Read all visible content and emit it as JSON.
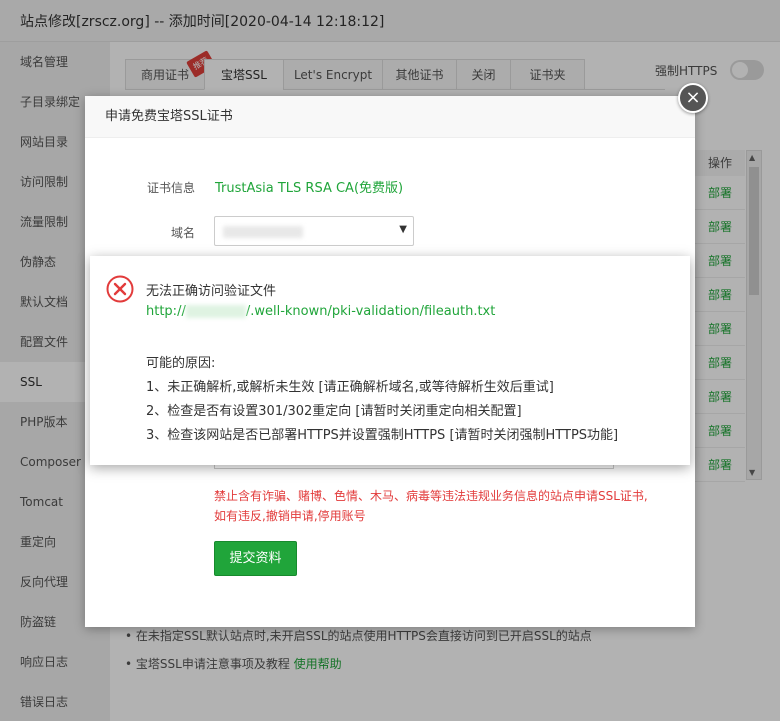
{
  "window": {
    "title": "站点修改[zrscz.org] -- 添加时间[2020-04-14 12:18:12]"
  },
  "sidebar": {
    "items": [
      {
        "label": "域名管理"
      },
      {
        "label": "子目录绑定"
      },
      {
        "label": "网站目录"
      },
      {
        "label": "访问限制"
      },
      {
        "label": "流量限制"
      },
      {
        "label": "伪静态"
      },
      {
        "label": "默认文档"
      },
      {
        "label": "配置文件"
      },
      {
        "label": "SSL"
      },
      {
        "label": "PHP版本"
      },
      {
        "label": "Composer"
      },
      {
        "label": "Tomcat"
      },
      {
        "label": "重定向"
      },
      {
        "label": "反向代理"
      },
      {
        "label": "防盗链"
      },
      {
        "label": "响应日志"
      },
      {
        "label": "错误日志"
      }
    ],
    "active_index": 8
  },
  "tabs": {
    "items": [
      {
        "label": "商用证书"
      },
      {
        "label": "宝塔SSL"
      },
      {
        "label": "Let's Encrypt"
      },
      {
        "label": "其他证书"
      },
      {
        "label": "关闭"
      },
      {
        "label": "证书夹"
      }
    ],
    "badge": "推荐",
    "active_index": 1
  },
  "https": {
    "label": "强制HTTPS",
    "enabled": false
  },
  "table": {
    "op_header": "操作",
    "op_links": [
      "部署",
      "部署",
      "部署",
      "部署",
      "部署",
      "部署",
      "部署",
      "部署",
      "部署"
    ]
  },
  "tips": [
    {
      "text": "在未指定SSL默认站点时,未开启SSL的站点使用HTTPS会直接访问到已开启SSL的站点",
      "link": ""
    },
    {
      "text": "宝塔SSL申请注意事项及教程 ",
      "link": "使用帮助"
    }
  ],
  "dialog": {
    "title": "申请免费宝塔SSL证书",
    "close_icon": "close-icon",
    "cert_label": "证书信息",
    "cert_value": "TrustAsia TLS RSA CA(免费版)",
    "domain_label": "域名",
    "domain_value": "",
    "warning_line1": "禁止含有诈骗、赌博、色情、木马、病毒等违法违规业务信息的站点申请SSL证书,",
    "warning_line2": "如有违反,撤销申请,停用账号",
    "submit_label": "提交资料"
  },
  "error": {
    "icon": "error-circle-icon",
    "title": "无法正确访问验证文件",
    "url_prefix": "http://",
    "url_suffix": "/.well-known/pki-validation/fileauth.txt",
    "reasons_title": "可能的原因:",
    "reasons": [
      "1、未正确解析,或解析未生效 [请正确解析域名,或等待解析生效后重试]",
      "2、检查是否有设置301/302重定向 [请暂时关闭重定向相关配置]",
      "3、检查该网站是否已部署HTTPS并设置强制HTTPS [请暂时关闭强制HTTPS功能]"
    ]
  },
  "colors": {
    "accent": "#20a53a",
    "error": "#e23b3b",
    "badge": "#e0403a"
  }
}
